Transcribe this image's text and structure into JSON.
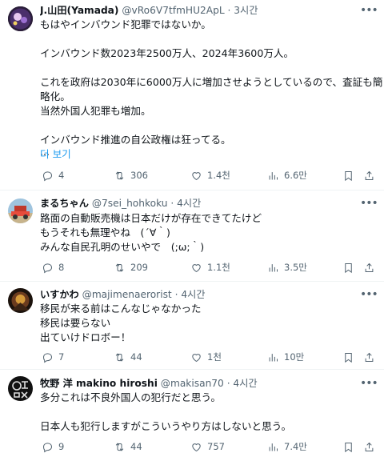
{
  "tweets": [
    {
      "name": "J.山田(Yamada)",
      "handle": "@vRo6V7tfmHU2ApL",
      "time": "· 3시간",
      "body": [
        "もはやインバウンド犯罪ではないか。",
        "",
        "インバウンド数2023年2500万人、2024年3600万人。",
        "",
        "これを政府は2030年に6000万人に増加させようとしているので、査証も簡",
        "略化。",
        "当然外国人犯罪も増加。",
        "",
        "インバウンド推進の自公政権は狂ってる。",
        "..."
      ],
      "read_more": "더 보기",
      "replies": "4",
      "retweets": "306",
      "likes": "1.4천",
      "views": "6.6만"
    },
    {
      "name": "まるちゃん",
      "handle": "@7sei_hohkoku",
      "time": "· 4시간",
      "body": [
        "路面の自動販売機は日本だけが存在できてたけど",
        "もうそれも無理やね　(´∀｀)",
        "みんな自民孔明のせいやで　(;ω;｀)"
      ],
      "replies": "8",
      "retweets": "209",
      "likes": "1.1천",
      "views": "3.5만"
    },
    {
      "name": "いすかわ",
      "handle": "@majimenaerorist",
      "time": "· 4시간",
      "body": [
        "移民が来る前はこんなじゃなかった",
        "移民は要らない",
        "出ていけドロボー！"
      ],
      "replies": "7",
      "retweets": "44",
      "likes": "1천",
      "views": "10만"
    },
    {
      "name": "牧野 洋 makino hiroshi",
      "handle": "@makisan70",
      "time": "· 4시간",
      "body": [
        "多分これは不良外国人の犯行だと思う。",
        "",
        "日本人も犯行しますがこういうやり方はしないと思う。"
      ],
      "replies": "9",
      "retweets": "44",
      "likes": "757",
      "views": "7.4만"
    }
  ],
  "icons": {
    "more": "more-horizontal-icon",
    "reply": "reply-bubble-icon",
    "retweet": "retweet-icon",
    "like": "heart-icon",
    "views": "views-bar-chart-icon",
    "bookmark": "bookmark-icon",
    "share": "share-icon"
  },
  "colors": {
    "link": "#1d9bf0",
    "secondary_text": "#536471",
    "divider": "#eff3f4"
  }
}
